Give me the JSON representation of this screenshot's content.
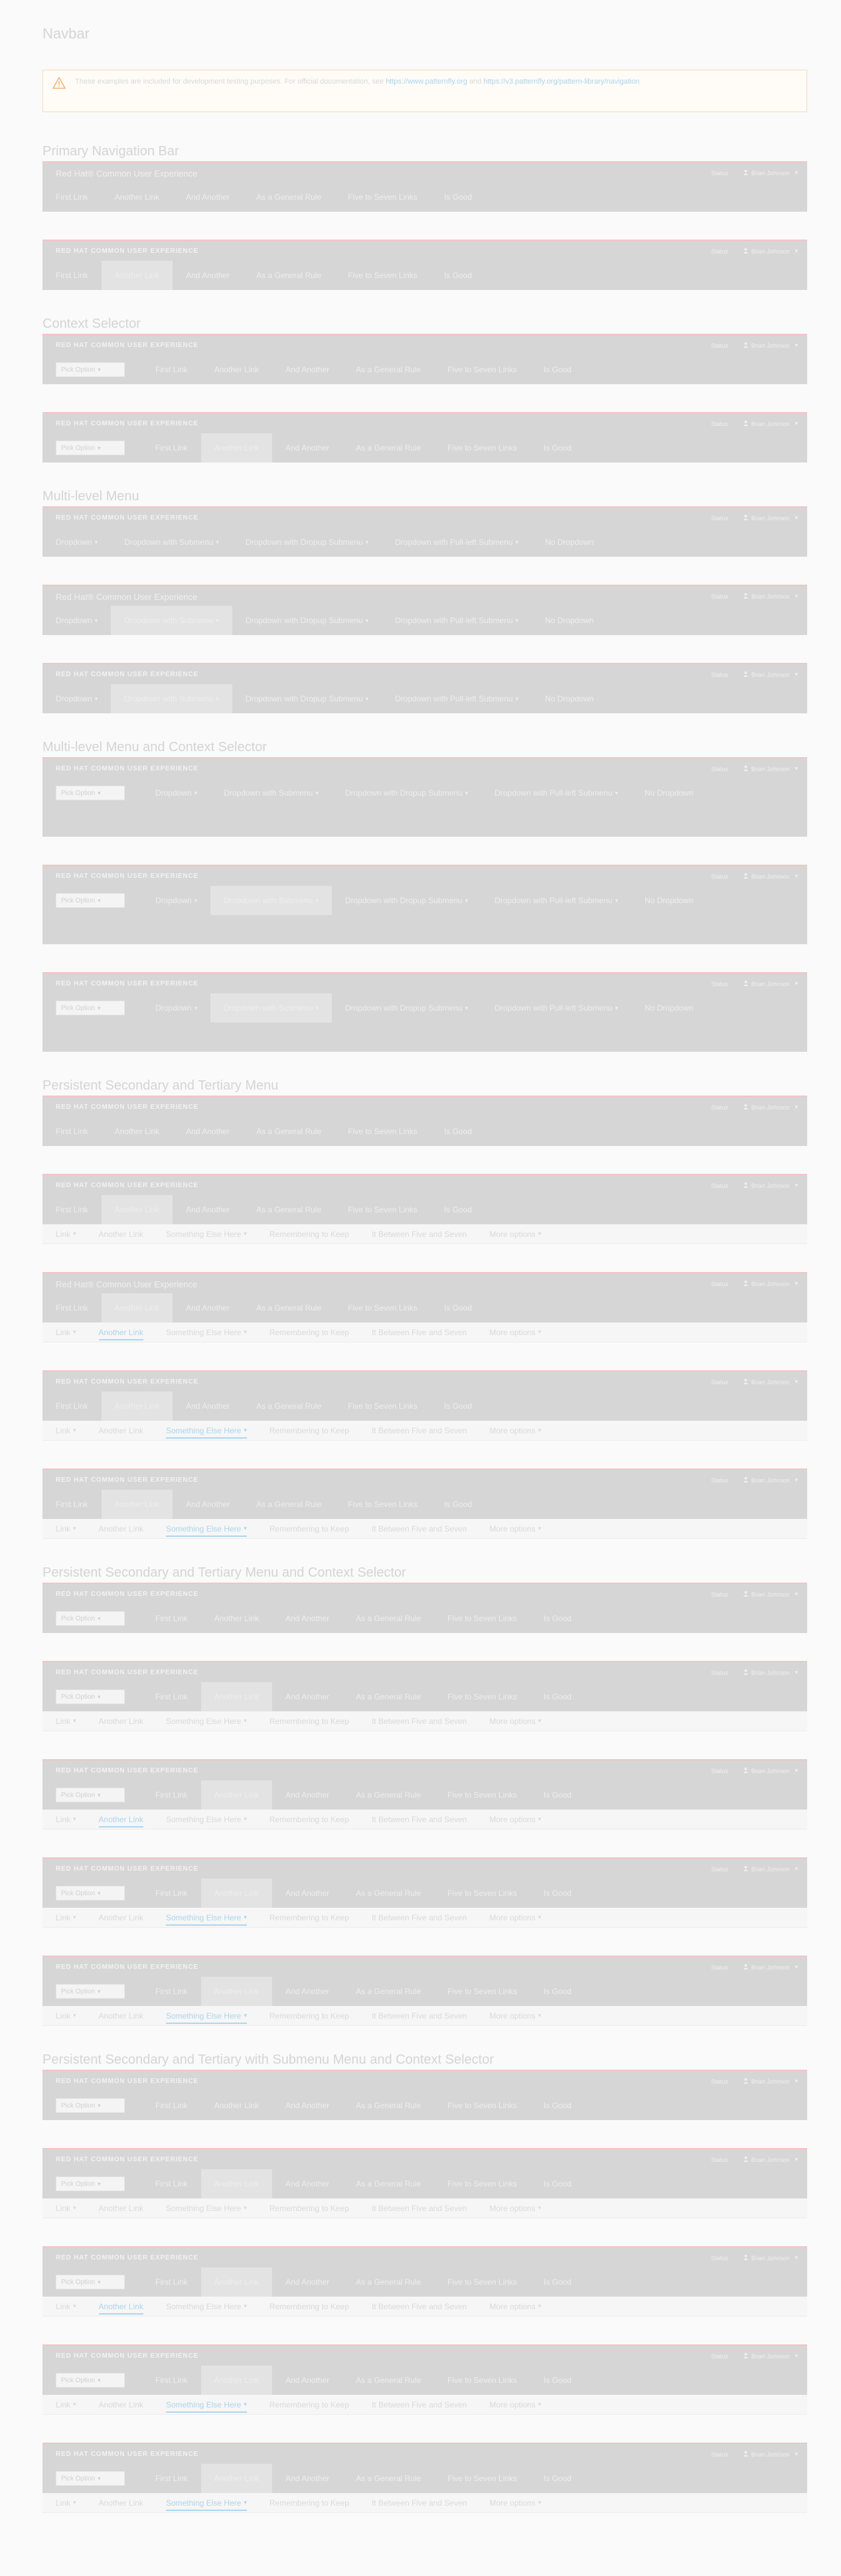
{
  "page": {
    "title": "Navbar",
    "alert": {
      "text": "These examples are included for development testing purposes. For official documentation, see",
      "link1": "https://www.patternfly.org",
      "and": "and",
      "link2": "https://v3.patternfly.org/pattern-library/navigation"
    }
  },
  "brand": {
    "text": "Red Hat® Common User Experience",
    "logo": "RED HAT  COMMON USER EXPERIENCE"
  },
  "utility": {
    "status": "Status",
    "user": "Brian Johnson"
  },
  "primary_items": [
    "First Link",
    "Another Link",
    "And Another",
    "As a General Rule",
    "Five to Seven Links",
    "Is Good"
  ],
  "dropdown_items": [
    "Dropdown",
    "Dropdown with Submenu",
    "Dropdown with Dropup Submenu",
    "Dropdown with Pull-left Submenu",
    "No Dropdown"
  ],
  "secondary_items": [
    "Link",
    "Another Link",
    "Something Else Here",
    "Remembering to Keep",
    "It Between Five and Seven",
    "More options"
  ],
  "context_label": "Pick Option",
  "sections": [
    "Primary Navigation Bar",
    "Context Selector",
    "Multi-level Menu",
    "Multi-level Menu and Context Selector",
    "Persistent Secondary and Tertiary Menu",
    "Persistent Secondary and Tertiary Menu and Context Selector",
    "Persistent Secondary and Tertiary with Submenu Menu and Context Selector"
  ],
  "colors": {
    "navbar_bg": "#d6d6d6",
    "accent_top": "#f3c4c4",
    "active_link": "#aed6ee",
    "alert_border": "#f6d9b8"
  },
  "icons": {
    "warning": "warning-triangle-icon",
    "user": "user-icon",
    "caret": "caret-down-icon"
  }
}
